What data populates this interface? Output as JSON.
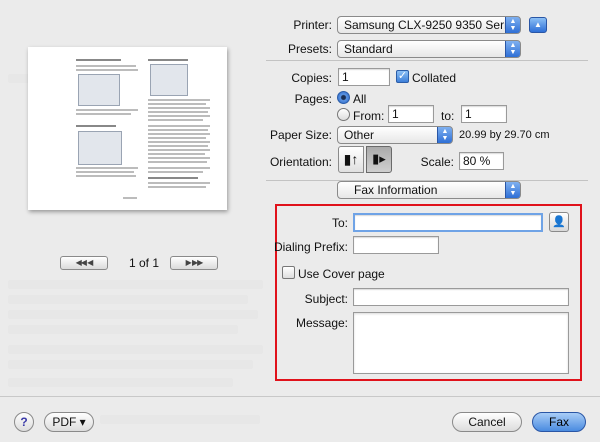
{
  "printer": {
    "label": "Printer:",
    "value": "Samsung CLX-9250 9350 Serie..."
  },
  "presets": {
    "label": "Presets:",
    "value": "Standard"
  },
  "copies": {
    "label": "Copies:",
    "value": "1",
    "collated_label": "Collated",
    "collated": true
  },
  "pages": {
    "label": "Pages:",
    "all_label": "All",
    "from_label": "From:",
    "from_value": "1",
    "to_label": "to:",
    "to_value": "1"
  },
  "paper": {
    "label": "Paper Size:",
    "value": "Other",
    "dimensions": "20.99 by 29.70 cm"
  },
  "orientation": {
    "label": "Orientation:"
  },
  "scale": {
    "label": "Scale:",
    "value": "80 %"
  },
  "section": {
    "value": "Fax Information"
  },
  "fax": {
    "to_label": "To:",
    "to_value": "",
    "prefix_label": "Dialing Prefix:",
    "prefix_value": "",
    "cover_label": "Use Cover page",
    "cover_checked": false,
    "subject_label": "Subject:",
    "subject_value": "",
    "message_label": "Message:",
    "message_value": ""
  },
  "preview": {
    "page_indicator": "1 of 1",
    "prev_glyph": "◀◀ ◀",
    "next_glyph": "▶ ▶▶"
  },
  "footer": {
    "help_glyph": "?",
    "pdf_label": "PDF ▾",
    "cancel_label": "Cancel",
    "fax_label": "Fax"
  },
  "colors": {
    "highlight_box": "#e0121b",
    "accent": "#2e6fd6"
  }
}
